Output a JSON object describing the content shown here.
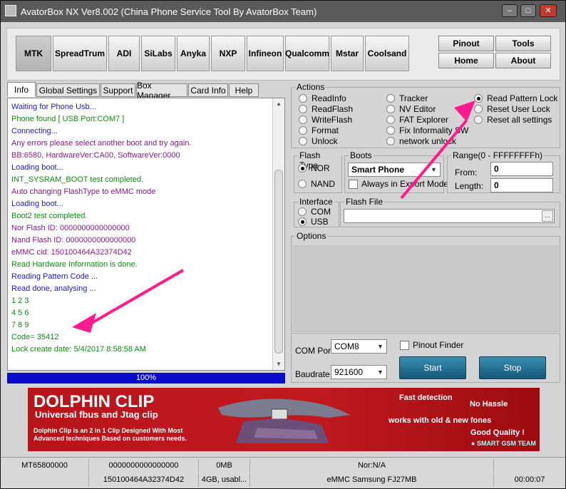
{
  "window": {
    "title": "AvatorBox NX Ver8.002 (China Phone Service Tool By AvatorBox Team)",
    "min_glyph": "–",
    "max_glyph": "□",
    "close_glyph": "✕"
  },
  "chips": [
    "MTK",
    "SpreadTrum",
    "ADI",
    "SiLabs",
    "Anyka",
    "NXP",
    "Infineon",
    "Qualcomm",
    "Mstar",
    "Coolsand"
  ],
  "right_buttons": {
    "pinout": "Pinout",
    "tools": "Tools",
    "home": "Home",
    "about": "About"
  },
  "tabs": [
    "Info",
    "Global Settings",
    "Support",
    "Box Manager",
    "Card Info",
    "Help"
  ],
  "log_lines": [
    {
      "text": "Waiting for Phone Usb...",
      "color": "#1a1ad0"
    },
    {
      "text": "Phone found [ USB Port:COM7 ]",
      "color": "#118a11"
    },
    {
      "text": "Connecting...",
      "color": "#1a1ad0"
    },
    {
      "text": "Any errors please select another boot and try again.",
      "color": "#8a1a8a"
    },
    {
      "text": "BB:6580,    HardwareVer:CA00,    SoftwareVer:0000",
      "color": "#8a1a8a"
    },
    {
      "text": "Loading boot...",
      "color": "#1a1ad0"
    },
    {
      "text": "INT_SYSRAM_BOOT test completed.",
      "color": "#118a11"
    },
    {
      "text": "Auto changing FlashType to eMMC mode",
      "color": "#8a1a8a"
    },
    {
      "text": "Loading boot...",
      "color": "#1a1ad0"
    },
    {
      "text": "Boot2 test completed.",
      "color": "#118a11"
    },
    {
      "text": "Nor Flash ID: 0000000000000000",
      "color": "#8a1a8a"
    },
    {
      "text": "Nand Flash ID: 0000000000000000",
      "color": "#8a1a8a"
    },
    {
      "text": "eMMC cid: 150100464A32374D42",
      "color": "#8a1a8a"
    },
    {
      "text": "Read Hardware Information is done.",
      "color": "#118a11"
    },
    {
      "text": "Reading Pattern Code ...",
      "color": "#1a1ad0"
    },
    {
      "text": "Read done, analysing ...",
      "color": "#1a1ad0"
    },
    {
      "text": "1  2  3",
      "color": "#118a11"
    },
    {
      "text": "4  5  6",
      "color": "#118a11"
    },
    {
      "text": "7  8  9",
      "color": "#118a11"
    },
    {
      "text": "Code= 35412",
      "color": "#118a11"
    },
    {
      "text": "Lock create date: 5/4/2017 8:58:58 AM",
      "color": "#118a11"
    }
  ],
  "progress": {
    "label": "100%",
    "value": 100
  },
  "actions": {
    "caption": "Actions",
    "col1": [
      "ReadInfo",
      "ReadFlash",
      "WriteFlash",
      "Format",
      "Unlock"
    ],
    "col2": [
      "Tracker",
      "NV Editor",
      "FAT Explorer",
      "Fix Informality SW",
      "network unlock"
    ],
    "col3": [
      "Read Pattern Lock",
      "Reset User Lock",
      "Reset all settings"
    ],
    "selected": "Read Pattern Lock"
  },
  "flash_type": {
    "caption": "Flash Type",
    "options": [
      "NOR",
      "NAND"
    ],
    "selected": "NOR"
  },
  "boots": {
    "caption": "Boots",
    "value": "Smart Phone",
    "always_label": "Always in Export Mode"
  },
  "range": {
    "caption": "Range(0 - FFFFFFFFh)",
    "from_label": "From:",
    "from_value": "0",
    "length_label": "Length:",
    "length_value": "0"
  },
  "interface": {
    "caption": "Interface",
    "options": [
      "COM",
      "USB"
    ],
    "selected": "USB"
  },
  "flash_file": {
    "caption": "Flash File",
    "browse": "..."
  },
  "options": {
    "caption": "Options"
  },
  "com": {
    "port_label": "COM Port",
    "port_value": "COM8",
    "baud_label": "Baudrate",
    "baud_value": "921600",
    "pinout_finder": "Pinout Finder"
  },
  "buttons": {
    "start": "Start",
    "stop": "Stop"
  },
  "banner": {
    "title": "DOLPHIN CLIP",
    "subtitle": "Universal fbus and Jtag clip",
    "desc": "Dolphin Clip is an 2 in 1 Clip Designed With Most Advanced techniques Based on customers needs.",
    "fast": "Fast detection",
    "hassle": "No Hassle",
    "works": "works with old & new fones",
    "quality": "Good Quality !",
    "team": "SMART GSM TEAM"
  },
  "status_row1": [
    "MT65800000",
    "0000000000000000",
    "0MB",
    "Nor:N/A",
    ""
  ],
  "status_row2": [
    "",
    "150100464A32374D42",
    "4GB,  usabl...",
    "eMMC  Samsung  FJ27MB",
    "00:00:07"
  ],
  "colors": {
    "progress": "#0a0acc",
    "arrow": "#ff1b8d",
    "start_btn": "#1f6f94",
    "banner": "#b8141a"
  }
}
